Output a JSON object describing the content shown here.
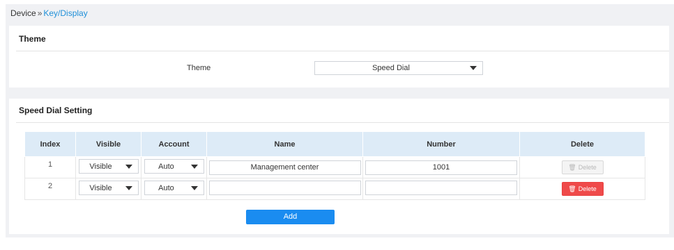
{
  "breadcrumb": {
    "root": "Device",
    "separator": "»",
    "current": "Key/Display"
  },
  "theme_section": {
    "title": "Theme",
    "field_label": "Theme",
    "selected_value": "Speed Dial"
  },
  "speed_dial_section": {
    "title": "Speed Dial Setting",
    "columns": [
      "Index",
      "Visible",
      "Account",
      "Name",
      "Number",
      "Delete"
    ],
    "rows": [
      {
        "index": "1",
        "visible": "Visible",
        "account": "Auto",
        "name": "Management center",
        "number": "1001",
        "delete_label": "Delete",
        "delete_enabled": false
      },
      {
        "index": "2",
        "visible": "Visible",
        "account": "Auto",
        "name": "",
        "number": "",
        "delete_label": "Delete",
        "delete_enabled": true
      }
    ],
    "add_label": "Add"
  },
  "colors": {
    "accent": "#1a8cf0",
    "link": "#1e8fd8",
    "header_bg": "#ddebf7",
    "danger": "#ef4a4a",
    "page_bg": "#f0f1f4"
  },
  "icons": {
    "delete": "trash-icon",
    "dropdown": "chevron-down-icon"
  }
}
